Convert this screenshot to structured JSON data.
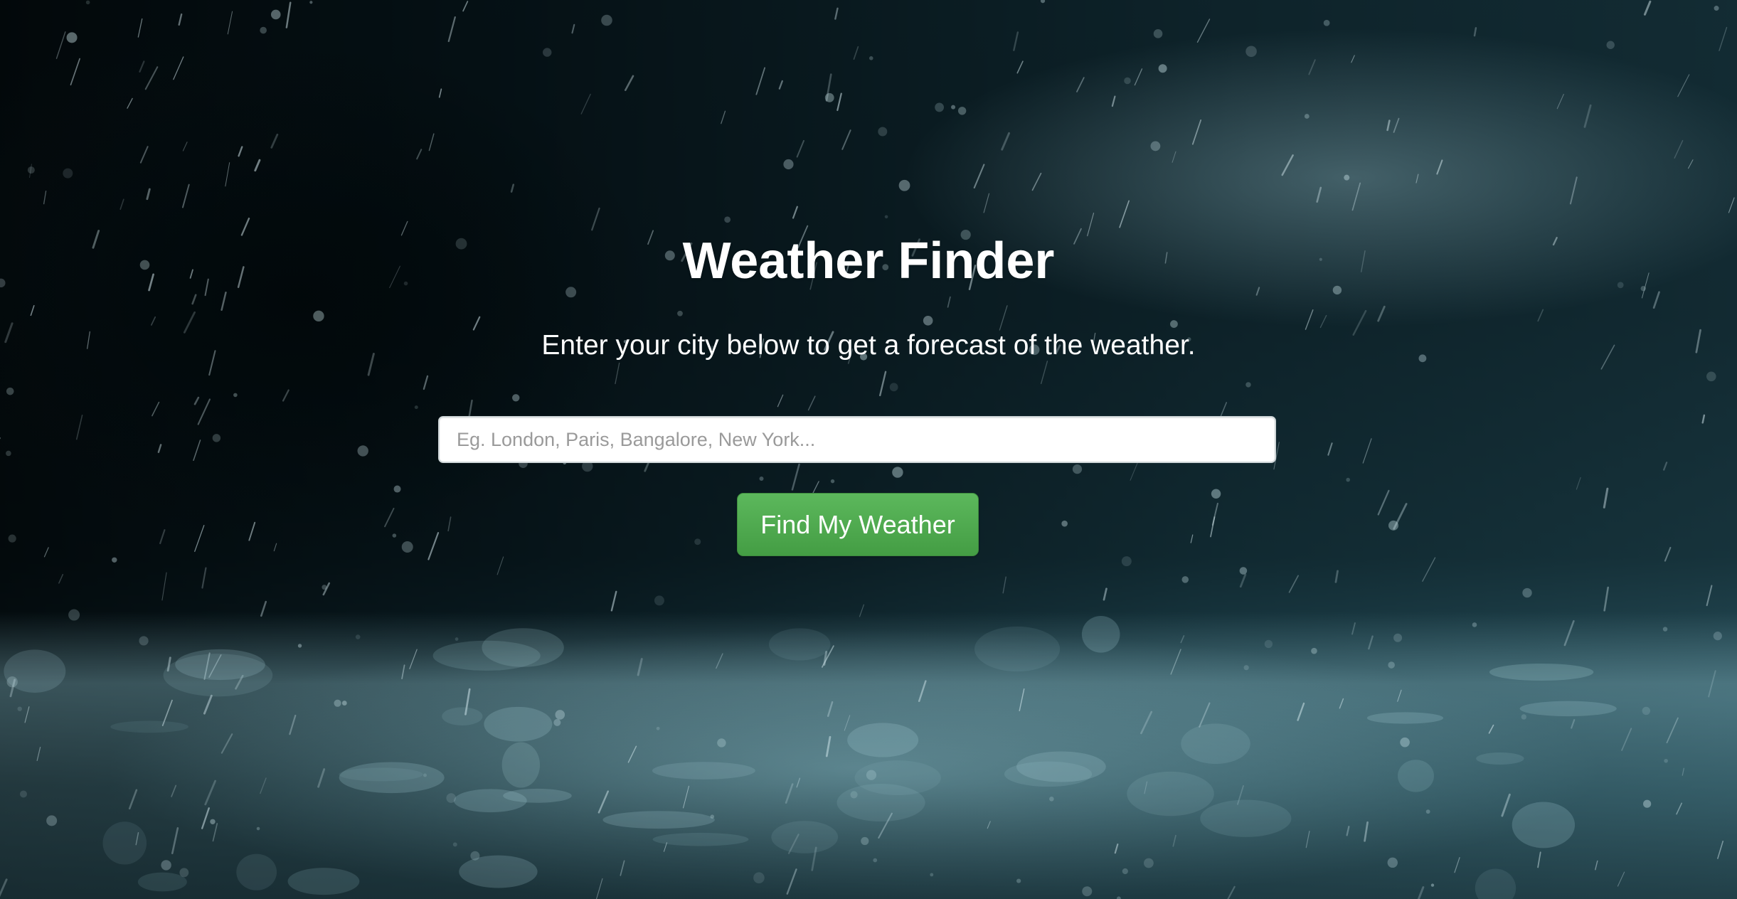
{
  "header": {
    "title": "Weather Finder",
    "subtitle": "Enter your city below to get a forecast of the weather."
  },
  "search": {
    "value": "",
    "placeholder": "Eg. London, Paris, Bangalore, New York..."
  },
  "actions": {
    "submit_label": "Find My Weather"
  },
  "colors": {
    "button": "#5cb85c",
    "text": "#ffffff"
  }
}
